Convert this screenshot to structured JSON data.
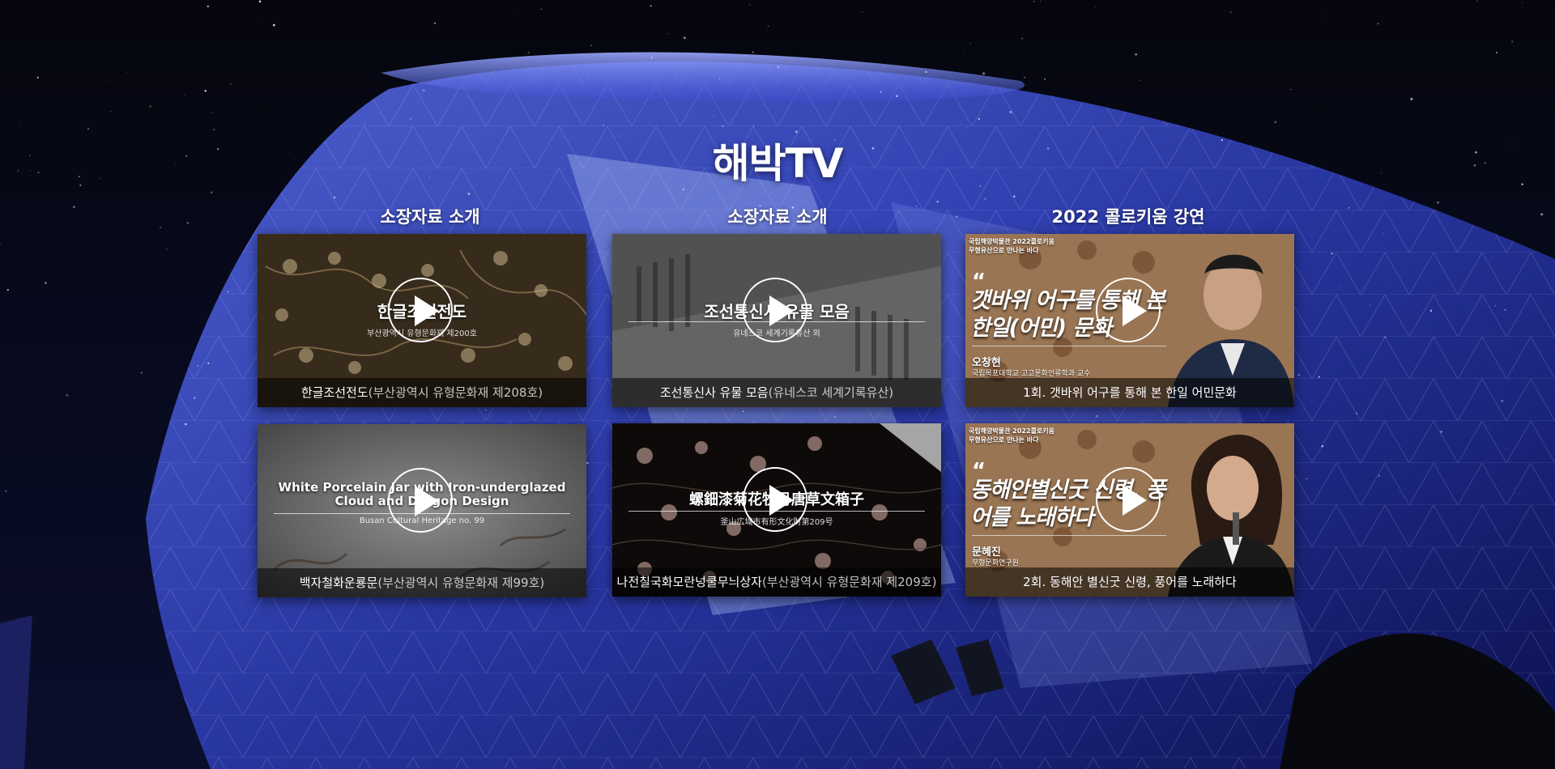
{
  "page": {
    "title": "해박TV"
  },
  "columns": [
    {
      "title": "소장자료 소개",
      "cards": [
        {
          "overlay_title": "한글조선전도",
          "overlay_sub": "부산광역시 유형문화재 제200호",
          "caption_main": "한글조선전도",
          "caption_paren": "(부산광역시 유형문화재 제208호)"
        },
        {
          "overlay_title": "White Porcelain Jar with Iron-underglazed Cloud and Dragon Design",
          "overlay_sub": "Busan Cultural Heritage no. 99",
          "caption_main": "백자철화운룡문",
          "caption_paren": "(부산광역시 유형문화재 제99호)"
        }
      ]
    },
    {
      "title": "소장자료 소개",
      "cards": [
        {
          "overlay_title": "조선통신사 유물 모음",
          "overlay_sub": "유네스코 세계기록유산 외",
          "caption_main": "조선통신사 유물 모음",
          "caption_paren": "(유네스코 세계기록유산)"
        },
        {
          "overlay_title": "螺鈿漆菊花牧丹唐草文箱子",
          "overlay_sub": "釜山広域市有形文化財第209号",
          "caption_main": "나전칠국화모란넝쿨무늬상자",
          "caption_paren": "(부산광역시 유형문화재 제209호)"
        }
      ]
    },
    {
      "title": "2022 콜로키움 강연",
      "cards": [
        {
          "badge_line1": "국립해양박물관 2022콜로키움",
          "badge_line2": "무형유산으로 만나는 바다",
          "quote_mark": "“",
          "lecture_title": "갯바위 어구를 통해 본 한일(어민) 문화",
          "speaker": "오창현",
          "affiliation": "국립목포대학교 고고문화인류학과 교수",
          "caption_main": "1회. 갯바위 어구를 통해 본 한일 어민문화",
          "caption_paren": ""
        },
        {
          "badge_line1": "국립해양박물관 2022콜로키움",
          "badge_line2": "무형유산으로 만나는 바다",
          "quote_mark": "“",
          "lecture_title": "동해안별신굿 신령, 풍어를 노래하다",
          "speaker": "문혜진",
          "affiliation": "무형문화연구원",
          "caption_main": "2회. 동해안 별신굿 신령, 풍어를 노래하다",
          "caption_paren": ""
        }
      ]
    }
  ],
  "icons": {
    "play": "play-icon"
  },
  "colors": {
    "overlay_caption_bg": "#000000",
    "night_sky": "#05060d",
    "building_blue": "#3a4fd8"
  }
}
